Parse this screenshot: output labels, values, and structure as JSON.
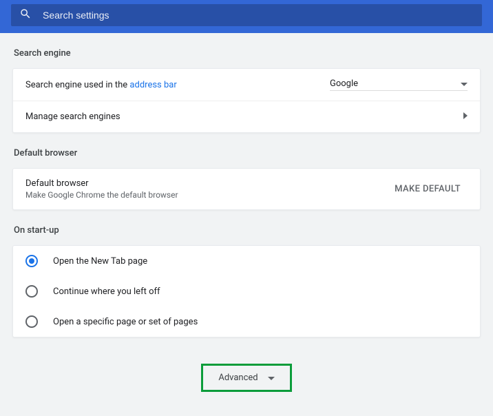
{
  "search": {
    "placeholder": "Search settings"
  },
  "sections": {
    "searchEngine": {
      "title": "Search engine",
      "row1_prefix": "Search engine used in the ",
      "row1_link": "address bar",
      "selected_engine": "Google",
      "row2_label": "Manage search engines"
    },
    "defaultBrowser": {
      "title": "Default browser",
      "row_title": "Default browser",
      "row_sub": "Make Google Chrome the default browser",
      "button": "Make default"
    },
    "startup": {
      "title": "On start-up",
      "options": [
        {
          "label": "Open the New Tab page",
          "selected": true
        },
        {
          "label": "Continue where you left off",
          "selected": false
        },
        {
          "label": "Open a specific page or set of pages",
          "selected": false
        }
      ]
    }
  },
  "advanced": {
    "label": "Advanced"
  }
}
